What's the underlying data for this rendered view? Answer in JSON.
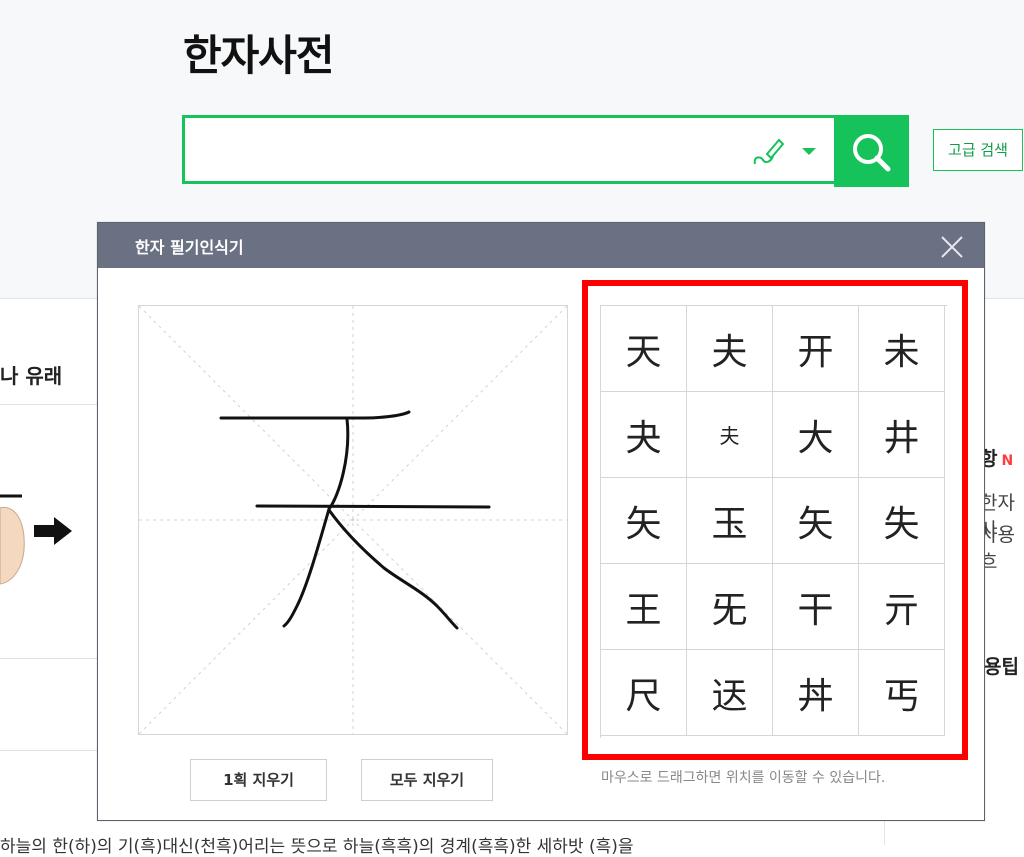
{
  "header": {
    "title": "한자사전",
    "search_placeholder": "",
    "advanced_search_label": "고급 검색"
  },
  "background": {
    "section_heading": "나 유래",
    "right_items": [
      {
        "label": "항",
        "badge": "N"
      },
      {
        "text": "한자사"
      },
      {
        "text": "사용흐"
      },
      {
        "label": "용팁"
      }
    ],
    "bottom_text": "하늘의 한(하)의 기(흑)대신(천흑)어리는 뜻으로 하늘(흑흑)의 경계(흑흑)한 세하밧 (흑)을"
  },
  "dialog": {
    "title": "한자 필기인식기",
    "erase_stroke_label": "1획 지우기",
    "erase_all_label": "모두 지우기",
    "hint": "마우스로 드래그하면 위치를 이동할 수 있습니다.",
    "candidates": [
      "天",
      "夫",
      "开",
      "未",
      "夬",
      "夫",
      "大",
      "井",
      "矢",
      "玉",
      "矢",
      "失",
      "王",
      "旡",
      "干",
      "亓",
      "尺",
      "迗",
      "丼",
      "丐"
    ]
  },
  "colors": {
    "accent": "#16c35a",
    "highlight": "#ff0000",
    "dialog_header": "#6a7183"
  }
}
